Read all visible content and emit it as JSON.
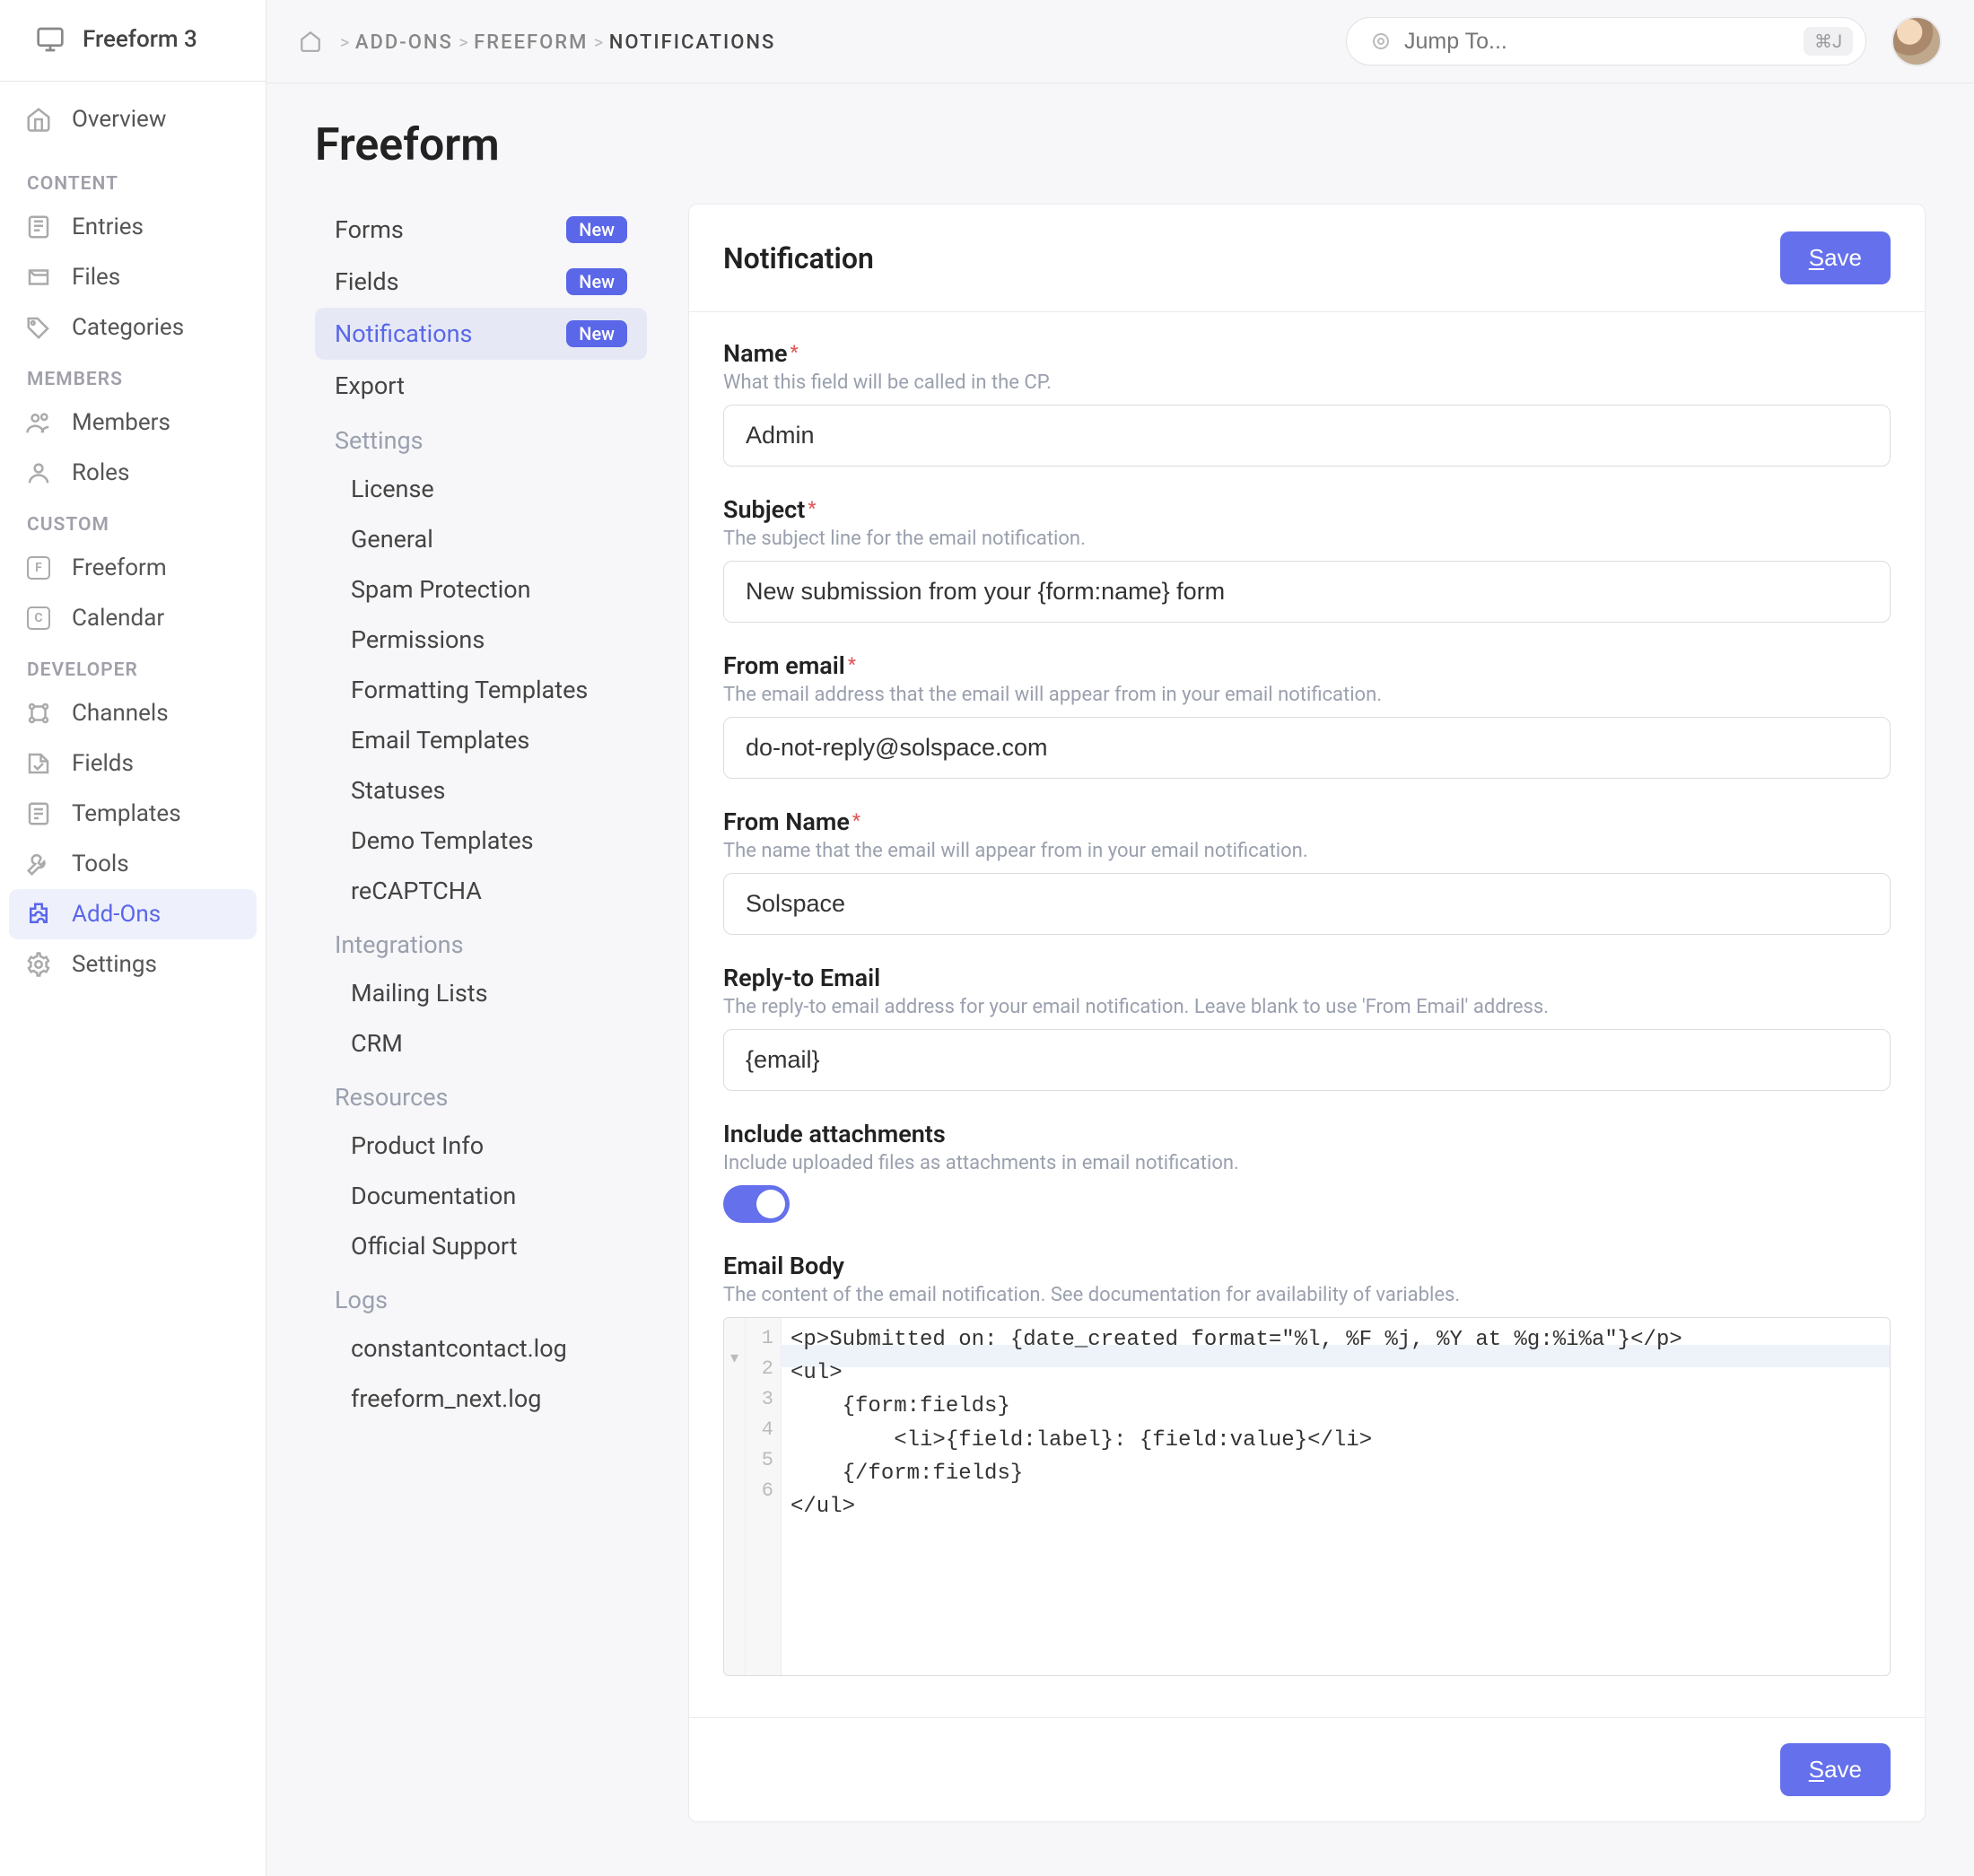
{
  "brand": "Freeform 3",
  "sidebar": {
    "top": {
      "label": "Overview"
    },
    "sections": [
      {
        "heading": "CONTENT",
        "items": [
          {
            "label": "Entries"
          },
          {
            "label": "Files"
          },
          {
            "label": "Categories"
          }
        ]
      },
      {
        "heading": "MEMBERS",
        "items": [
          {
            "label": "Members"
          },
          {
            "label": "Roles"
          }
        ]
      },
      {
        "heading": "CUSTOM",
        "items": [
          {
            "label": "Freeform",
            "boxed": "F"
          },
          {
            "label": "Calendar",
            "boxed": "C"
          }
        ]
      },
      {
        "heading": "DEVELOPER",
        "items": [
          {
            "label": "Channels"
          },
          {
            "label": "Fields"
          },
          {
            "label": "Templates"
          },
          {
            "label": "Tools"
          },
          {
            "label": "Add-Ons",
            "active": true
          },
          {
            "label": "Settings"
          }
        ]
      }
    ]
  },
  "breadcrumb": {
    "items": [
      "ADD-ONS",
      "FREEFORM",
      "NOTIFICATIONS"
    ]
  },
  "search": {
    "placeholder": "Jump To...",
    "kbd": "⌘J"
  },
  "page_title": "Freeform",
  "subnav": {
    "primary": [
      {
        "label": "Forms",
        "badge": "New"
      },
      {
        "label": "Fields",
        "badge": "New"
      },
      {
        "label": "Notifications",
        "badge": "New",
        "active": true
      },
      {
        "label": "Export"
      }
    ],
    "groups": [
      {
        "heading": "Settings",
        "items": [
          "License",
          "General",
          "Spam Protection",
          "Permissions",
          "Formatting Templates",
          "Email Templates",
          "Statuses",
          "Demo Templates",
          "reCAPTCHA"
        ]
      },
      {
        "heading": "Integrations",
        "items": [
          "Mailing Lists",
          "CRM"
        ]
      },
      {
        "heading": "Resources",
        "items": [
          "Product Info",
          "Documentation",
          "Official Support"
        ]
      },
      {
        "heading": "Logs",
        "items": [
          "constantcontact.log",
          "freeform_next.log"
        ]
      }
    ]
  },
  "panel": {
    "title": "Notification",
    "save": "Save",
    "fields": {
      "name": {
        "label": "Name",
        "desc": "What this field will be called in the CP.",
        "value": "Admin",
        "req": true
      },
      "subject": {
        "label": "Subject",
        "desc": "The subject line for the email notification.",
        "value": "New submission from your {form:name} form",
        "req": true
      },
      "from_email": {
        "label": "From email",
        "desc": "The email address that the email will appear from in your email notification.",
        "value": "do-not-reply@solspace.com",
        "req": true
      },
      "from_name": {
        "label": "From Name",
        "desc": "The name that the email will appear from in your email notification.",
        "value": "Solspace",
        "req": true
      },
      "reply_to": {
        "label": "Reply-to Email",
        "desc": "The reply-to email address for your email notification. Leave blank to use 'From Email' address.",
        "value": "{email}",
        "req": false
      },
      "attachments": {
        "label": "Include attachments",
        "desc": "Include uploaded files as attachments in email notification.",
        "on": true
      },
      "body": {
        "label": "Email Body",
        "desc": "The content of the email notification. See documentation for availability of variables."
      }
    },
    "code_lines": [
      "<p>Submitted on: {date_created format=\"%l, %F %j, %Y at %g:%i%a\"}</p>",
      "<ul>",
      "    {form:fields}",
      "        <li>{field:label}: {field:value}</li>",
      "    {/form:fields}",
      "</ul>"
    ]
  }
}
